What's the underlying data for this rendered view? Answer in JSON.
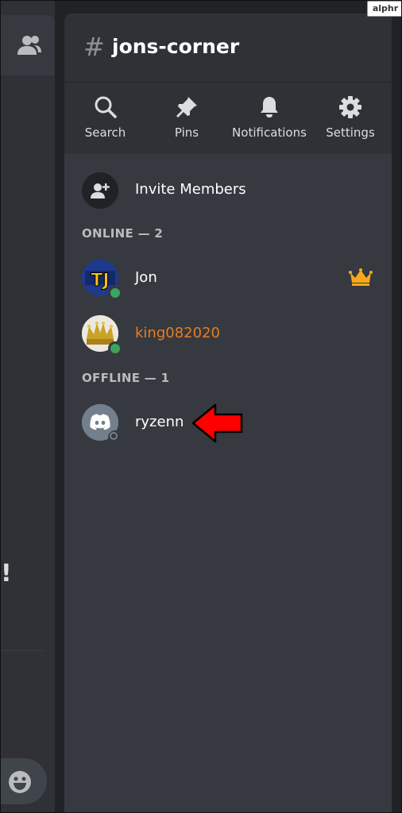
{
  "channel": {
    "hash": "#",
    "name": "jons-corner"
  },
  "toolbar": {
    "search_label": "Search",
    "pins_label": "Pins",
    "notifications_label": "Notifications",
    "settings_label": "Settings"
  },
  "invite": {
    "label": "Invite Members"
  },
  "sections": {
    "online_title": "ONLINE — 2",
    "offline_title": "OFFLINE — 1"
  },
  "members": [
    {
      "name": "Jon",
      "status": "online",
      "name_color": "#ffffff",
      "avatar_text": "TJ",
      "is_owner": true
    },
    {
      "name": "king082020",
      "status": "online",
      "name_color": "#e67e22",
      "is_owner": false
    },
    {
      "name": "ryzenn",
      "status": "offline",
      "name_color": "#ffffff",
      "is_owner": false
    }
  ],
  "left_column": {
    "partial_glyph": "!"
  },
  "colors": {
    "status_online": "#3ba55c",
    "status_offline": "#747f8d",
    "crown": "#faa81a",
    "arrow": "#ff0000"
  },
  "brand_badge": "alphr"
}
